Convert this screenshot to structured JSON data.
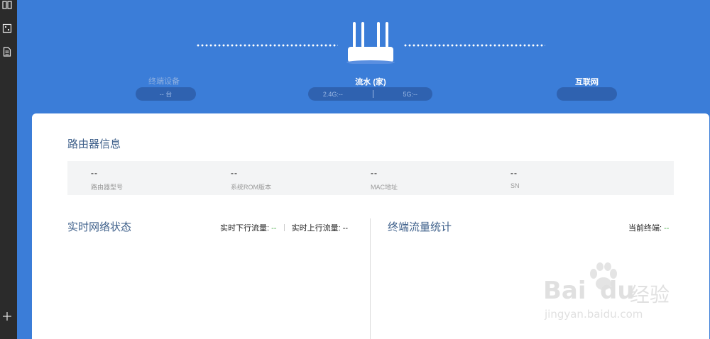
{
  "sidebar": {
    "icons": [
      "book-icon",
      "image-icon",
      "document-icon",
      "plus-icon"
    ]
  },
  "topology": {
    "devices": {
      "title": "终端设备",
      "count": "-- 台"
    },
    "router": {
      "title": "流水 (家)",
      "band_24": "2.4G:--",
      "band_5": "5G:--"
    },
    "internet": {
      "title": "互联网"
    }
  },
  "router_info": {
    "title": "路由器信息",
    "fields": [
      {
        "value": "--",
        "label": "路由器型号"
      },
      {
        "value": "--",
        "label": "系统ROM版本"
      },
      {
        "value": "--",
        "label": "MAC地址"
      },
      {
        "value": "--",
        "label": "SN"
      }
    ]
  },
  "network_status": {
    "title": "实时网络状态",
    "download_label": "实时下行流量:",
    "download_value": "--",
    "upload_label": "实时上行流量:",
    "upload_value": "--"
  },
  "terminal_stats": {
    "title": "终端流量统计",
    "current_label": "当前终端:",
    "current_value": "--"
  },
  "watermark": {
    "brand": "Bai",
    "brand2": "du",
    "cn": "经验",
    "url": "jingyan.baidu.com"
  },
  "colors": {
    "header_bg": "#3b7dd8",
    "pill_bg": "#2f62b0",
    "accent_green": "#5ab35a",
    "title_blue": "#3d5f8a"
  }
}
